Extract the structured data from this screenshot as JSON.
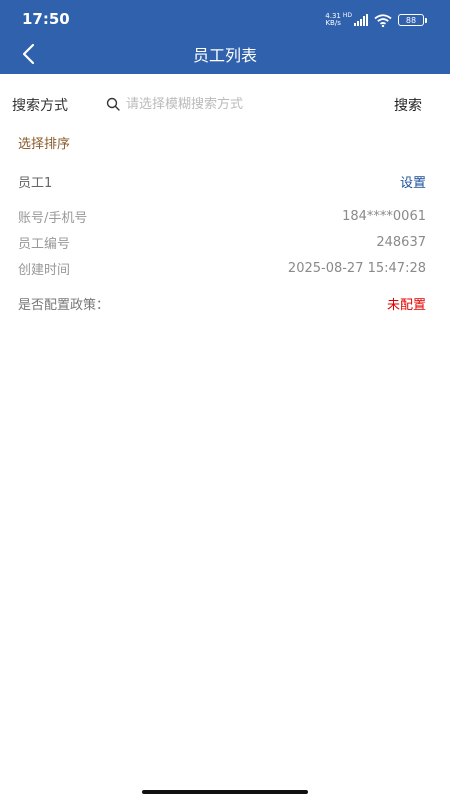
{
  "status_bar": {
    "time": "17:50",
    "network_speed": "4.31 KB/s",
    "network_type": "HD",
    "battery": "88"
  },
  "header": {
    "title": "员工列表"
  },
  "search": {
    "label": "搜索方式",
    "placeholder": "请选择模糊搜索方式",
    "button": "搜索"
  },
  "sort": {
    "label": "选择排序"
  },
  "employee": {
    "name": "员工1",
    "setting_label": "设置",
    "fields": [
      {
        "label": "账号/手机号",
        "value": "184****0061"
      },
      {
        "label": "员工编号",
        "value": "248637"
      },
      {
        "label": "创建时间",
        "value": "2025-08-27 15:47:28"
      }
    ],
    "policy": {
      "label": "是否配置政策：",
      "value": "未配置"
    }
  },
  "colors": {
    "header_bg": "#2f61ad",
    "sort_label": "#8b5a2b",
    "setting_link": "#1e4f9c",
    "unconfigured": "#e00000"
  }
}
